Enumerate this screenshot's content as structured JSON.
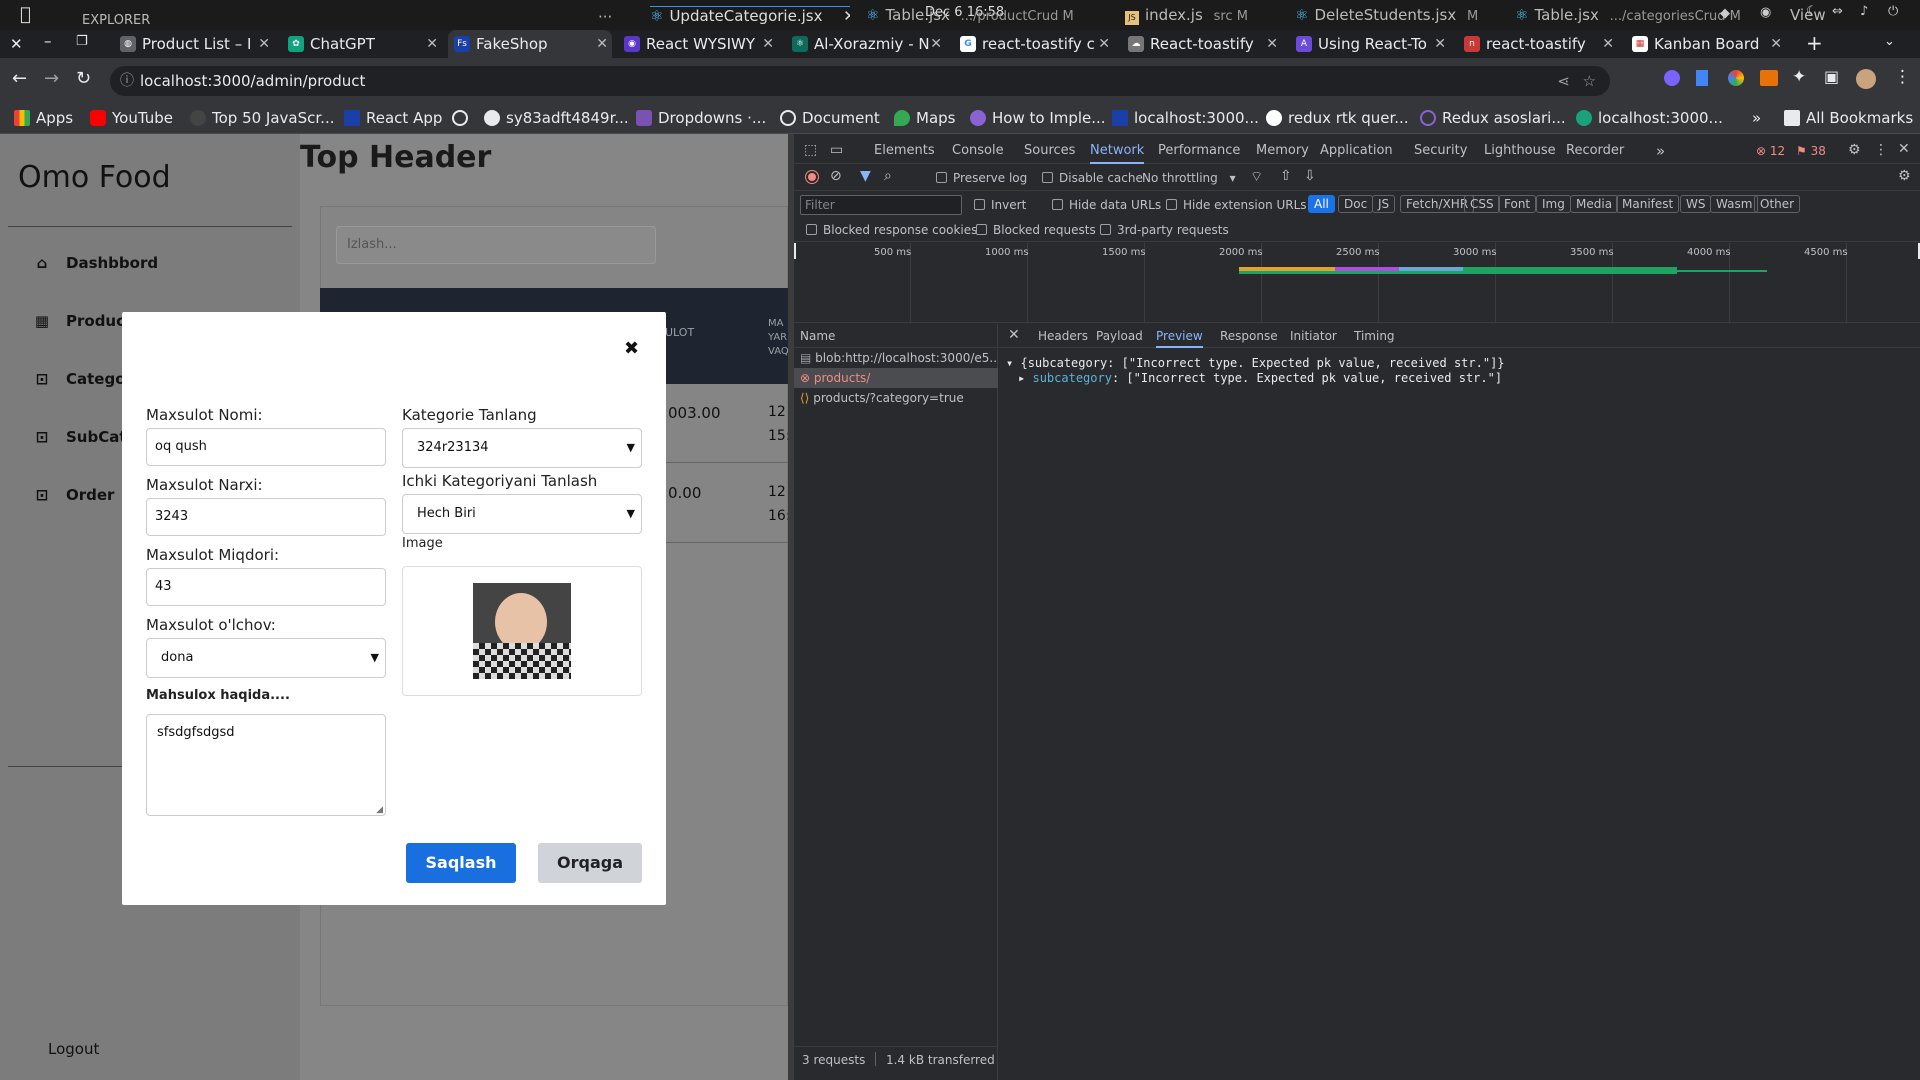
{
  "system_bar": {
    "explorer_label": "EXPLORER",
    "more": "···",
    "clock": "Dec 6  16:58",
    "editor_tabs": [
      {
        "name": "UpdateCategorie.jsx",
        "path": ""
      },
      {
        "name": "Table.jsx",
        "path": ".../productCrud  M"
      },
      {
        "name": "index.js",
        "path": "src  M"
      },
      {
        "name": "DeleteStudents.jsx",
        "path": "M"
      },
      {
        "name": "Table.jsx",
        "path": ".../categoriesCrud  M"
      },
      {
        "name": "View",
        "path": ""
      }
    ]
  },
  "browser_tabs": [
    {
      "title": "Product List – I",
      "favicon": "globe"
    },
    {
      "title": "ChatGPT",
      "favicon": "chatgpt"
    },
    {
      "title": "FakeShop",
      "favicon": "Fs"
    },
    {
      "title": "React WYSIWY",
      "favicon": "react"
    },
    {
      "title": "Al-Xorazmiy - N",
      "favicon": "atom"
    },
    {
      "title": "react-toastify c",
      "favicon": "google"
    },
    {
      "title": "React-toastify",
      "favicon": "cloud"
    },
    {
      "title": "Using React-To",
      "favicon": "A"
    },
    {
      "title": "react-toastify",
      "favicon": "npm"
    },
    {
      "title": "Kanban Board",
      "favicon": "trello"
    }
  ],
  "address_bar": {
    "url": "localhost:3000/admin/product"
  },
  "bookmarks": [
    "Apps",
    "YouTube",
    "Top 50 JavaScr...",
    "React App",
    "",
    "sy83adft4849r...",
    "Dropdowns ·...",
    "Document",
    "Maps",
    "How to Imple...",
    "localhost:3000...",
    "redux rtk quer...",
    "Redux asoslari...",
    "localhost:3000...",
    "»",
    "All Bookmarks"
  ],
  "app": {
    "brand": "Omo Food",
    "top_header": "Top Header",
    "search_placeholder": "Izlash...",
    "sidebar": [
      {
        "label": "Dashbbord",
        "icon": "home-icon"
      },
      {
        "label": "Products",
        "icon": "grid-icon"
      },
      {
        "label": "Categories",
        "icon": "bag-icon"
      },
      {
        "label": "SubCategories",
        "icon": "bag-icon"
      },
      {
        "label": "Order",
        "icon": "bag-icon"
      }
    ],
    "logout": "Logout",
    "table_headers": [
      "ULOT",
      "MA",
      "YAR",
      "VAQ"
    ],
    "table_cells": [
      "003.00",
      "12",
      "15:",
      "0.00",
      "12",
      "16:"
    ]
  },
  "modal": {
    "close": "✖",
    "name_label": "Maxsulot Nomi:",
    "name_value": "oq qush",
    "price_label": "Maxsulot Narxi:",
    "price_value": "3243",
    "qty_label": "Maxsulot Miqdori:",
    "qty_value": "43",
    "unit_label": "Maxsulot o'lchov:",
    "unit_value": "dona",
    "desc_label": "Mahsulox haqida....",
    "desc_value": "sfsdgfsdgsd",
    "category_label": "Kategorie Tanlang",
    "category_value": "324r23134",
    "subcategory_label": "Ichki Kategoriyani Tanlash",
    "subcategory_value": "Hech Biri",
    "image_label": "Image",
    "save": "Saqlash",
    "back": "Orqaga"
  },
  "devtools": {
    "tabs": [
      "Elements",
      "Console",
      "Sources",
      "Network",
      "Performance",
      "Memory",
      "Application",
      "Security",
      "Lighthouse",
      "Recorder",
      "»"
    ],
    "active_tab": "Network",
    "errors": "12",
    "warnings": "38",
    "preserve_log": "Preserve log",
    "disable_cache": "Disable cache",
    "throttling": "No throttling",
    "filter_placeholder": "Filter",
    "invert": "Invert",
    "hide_data_urls": "Hide data URLs",
    "hide_ext_urls": "Hide extension URLs",
    "type_filters": [
      "All",
      "Doc",
      "JS",
      "Fetch/XHR",
      "CSS",
      "Font",
      "Img",
      "Media",
      "Manifest",
      "WS",
      "Wasm",
      "Other"
    ],
    "blocked_cookies": "Blocked response cookies",
    "blocked_requests": "Blocked requests",
    "third_party": "3rd-party requests",
    "timeline_ticks": [
      "500 ms",
      "1000 ms",
      "1500 ms",
      "2000 ms",
      "2500 ms",
      "3000 ms",
      "3500 ms",
      "4000 ms",
      "4500 ms"
    ],
    "name_header": "Name",
    "requests": [
      {
        "name": "blob:http://localhost:3000/e5...",
        "status": "blob"
      },
      {
        "name": "products/",
        "status": "error"
      },
      {
        "name": "products/?category=true",
        "status": "ok"
      }
    ],
    "detail_tabs": [
      "Headers",
      "Payload",
      "Preview",
      "Response",
      "Initiator",
      "Timing"
    ],
    "active_detail_tab": "Preview",
    "preview_line1": "{subcategory: [\"Incorrect type. Expected pk value, received str.\"]}",
    "preview_key": "subcategory",
    "preview_line2": ": [\"Incorrect type. Expected pk value, received str.\"]",
    "summary_requests": "3 requests",
    "summary_transferred": "1.4 kB transferred"
  },
  "colors": {
    "accent_blue": "#1a6fe0",
    "error_red": "#f28b82",
    "devtools_bg": "#292a2d",
    "active_tab_blue": "#8ab4f8"
  }
}
